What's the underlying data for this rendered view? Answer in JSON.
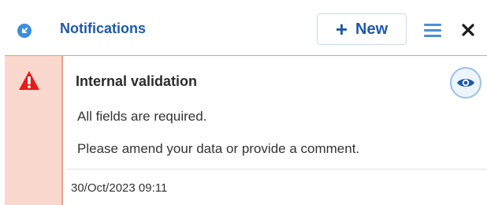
{
  "header": {
    "title": "Notifications",
    "new_button_label": "New",
    "new_button_icon": "plus-icon",
    "collapse_icon": "collapse-arrow-icon",
    "menu_icon": "hamburger-menu-icon",
    "close_icon": "close-icon"
  },
  "notification": {
    "severity_icon": "warning-icon",
    "title": "Internal validation",
    "lines": [
      "All fields are required.",
      "Please amend your data or provide a comment."
    ],
    "timestamp": "30/Oct/2023 09:11",
    "view_icon": "eye-icon"
  },
  "colors": {
    "brand_blue": "#1e5aa8",
    "warning_red": "#e51c1c",
    "warning_bg": "#fbd8cd",
    "warning_border": "#e8a08a"
  }
}
